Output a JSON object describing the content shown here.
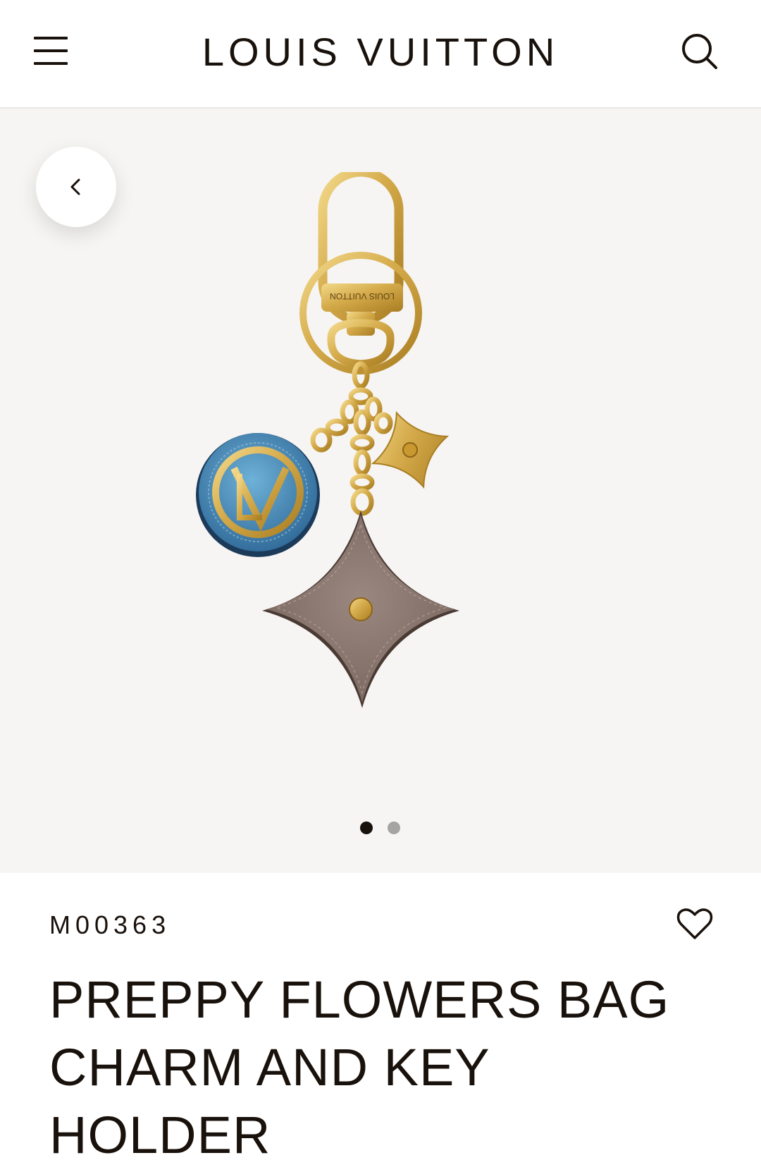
{
  "header": {
    "brand": "LOUIS VUITTON",
    "menu_icon": "hamburger-menu-icon",
    "search_icon": "search-icon"
  },
  "gallery": {
    "back_icon": "chevron-left-icon",
    "image_count": 2,
    "active_index": 1,
    "product_image": "bag-charm-product-image",
    "plate_text": "LOUIS VUITTON"
  },
  "product": {
    "sku": "M00363",
    "title": "PREPPY FLOWERS BAG CHARM AND KEY HOLDER",
    "wishlist_icon": "heart-outline-icon"
  },
  "colors": {
    "text": "#19110b",
    "gallery_bg": "#f6f5f3",
    "gold": "#d4aa4a",
    "leather_blue": "#3b7cad",
    "leather_taupe": "#8a7770",
    "dot_active": "#19110b",
    "dot_inactive": "#a5a4a2"
  }
}
